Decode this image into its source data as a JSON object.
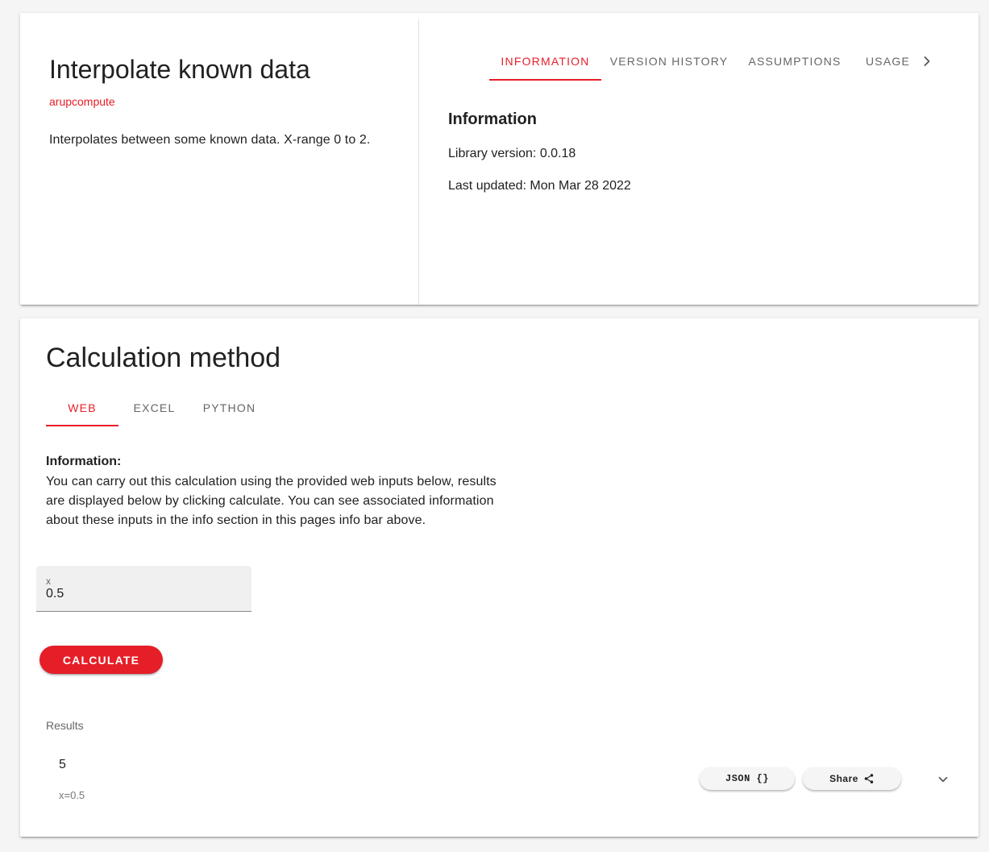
{
  "header": {
    "title": "Interpolate known data",
    "owner": "arupcompute",
    "description": "Interpolates between some known data. X-range 0 to 2."
  },
  "info_tabs": [
    {
      "label": "INFORMATION",
      "active": true
    },
    {
      "label": "VERSION HISTORY",
      "active": false
    },
    {
      "label": "ASSUMPTIONS",
      "active": false
    },
    {
      "label": "USAGE",
      "active": false
    }
  ],
  "info_panel": {
    "heading": "Information",
    "library_version": "Library version: 0.0.18",
    "last_updated": "Last updated: Mon Mar 28 2022"
  },
  "calc": {
    "title": "Calculation method",
    "tabs": [
      {
        "label": "WEB",
        "active": true
      },
      {
        "label": "EXCEL",
        "active": false
      },
      {
        "label": "PYTHON",
        "active": false
      }
    ],
    "info_label": "Information:",
    "info_text": "You can carry out this calculation using the provided web inputs below, results are displayed below by clicking calculate. You can see associated information about these inputs in the info section in this pages info bar above.",
    "input": {
      "label": "x",
      "value": "0.5"
    },
    "calculate_label": "CALCULATE"
  },
  "results": {
    "label": "Results",
    "value": "5",
    "sub": "x=0.5",
    "json_label": "JSON {}",
    "share_label": "Share"
  },
  "icons": {
    "tabs_next": "chevron-right-icon",
    "share": "share-icon",
    "expand": "chevron-down-icon"
  },
  "colors": {
    "accent": "#e61e28",
    "background": "#f5f5f5",
    "card": "#ffffff"
  }
}
